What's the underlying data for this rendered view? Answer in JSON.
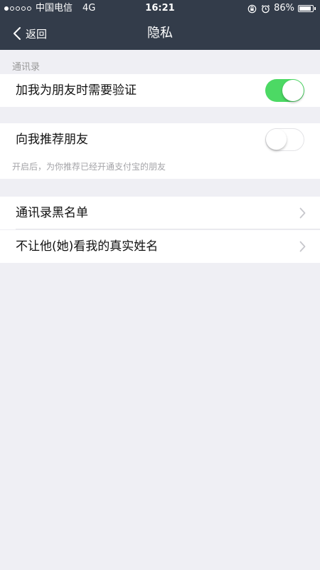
{
  "status_bar": {
    "carrier": "中国电信",
    "network": "4G",
    "time": "16:21",
    "battery": "86%",
    "icons": [
      "signal-dots",
      "rotation-lock-icon",
      "alarm-icon",
      "battery-icon"
    ]
  },
  "nav": {
    "back_label": "返回",
    "title": "隐私"
  },
  "section_contacts": {
    "header": "通讯录"
  },
  "setting_verify": {
    "label": "加我为朋友时需要验证",
    "enabled": true
  },
  "setting_recommend": {
    "label": "向我推荐朋友",
    "enabled": false,
    "note": "开启后，为你推荐已经开通支付宝的朋友"
  },
  "list": {
    "items": [
      {
        "label": "通讯录黑名单"
      },
      {
        "label": "不让他(她)看我的真实姓名"
      }
    ]
  },
  "colors": {
    "nav_bg": "#333c4a",
    "toggle_on": "#4cd964",
    "page_bg": "#efeff4"
  }
}
